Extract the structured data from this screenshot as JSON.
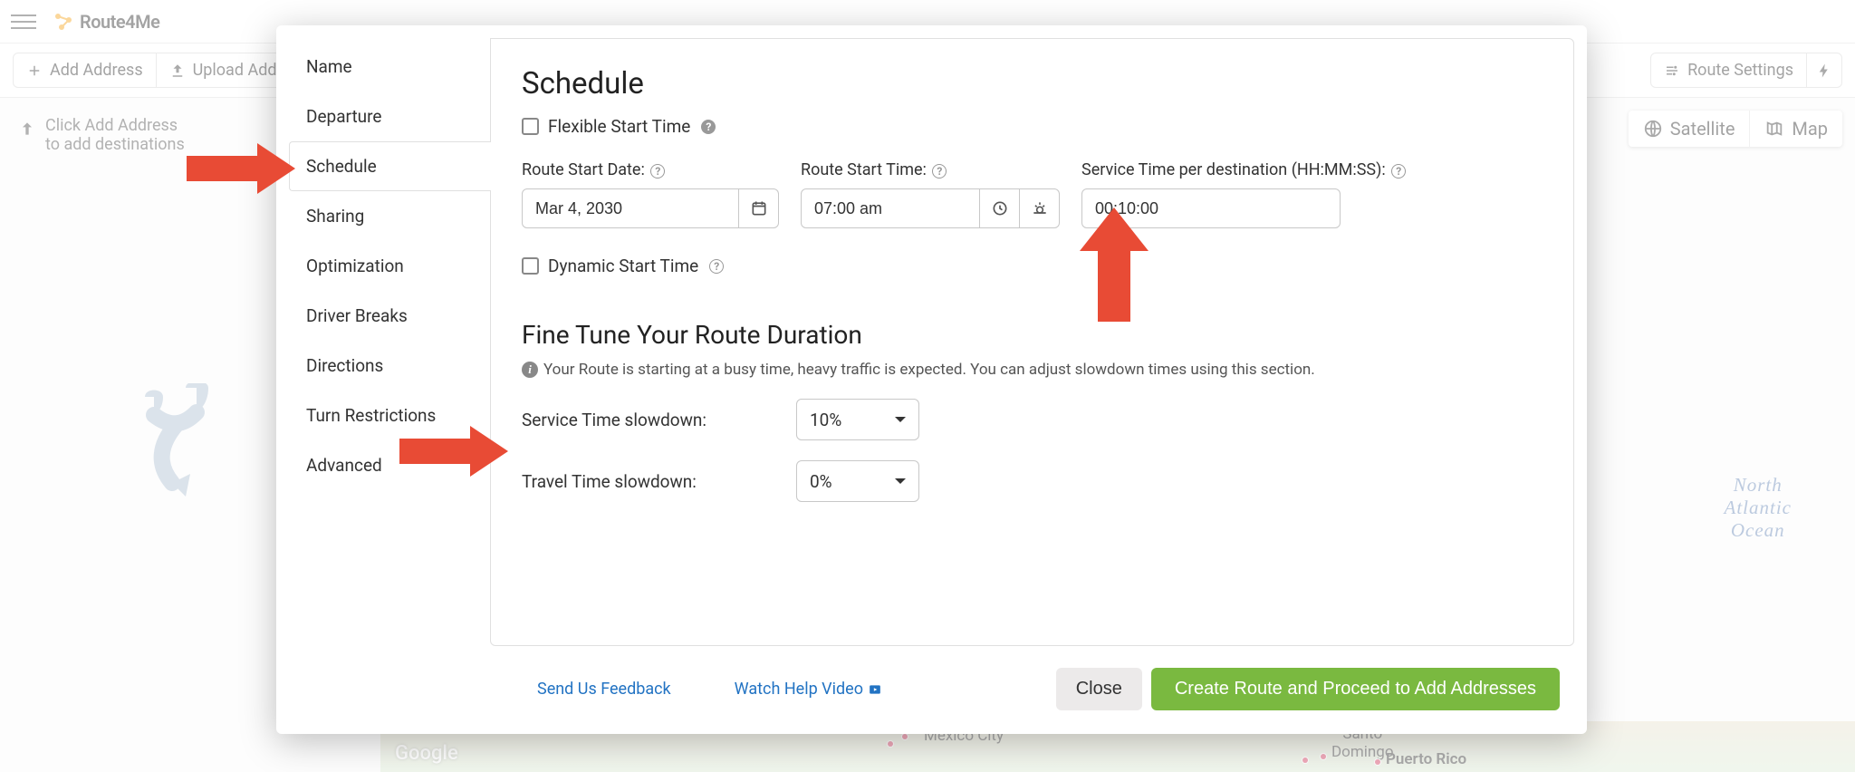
{
  "header": {
    "brand": "Route4Me"
  },
  "toolbar": {
    "add_address": "Add Address",
    "upload_addresses": "Upload Addresses",
    "route_settings": "Route Settings"
  },
  "hint": {
    "line1": "Click Add Address",
    "line2": "to add destinations"
  },
  "map": {
    "satellite": "Satellite",
    "map": "Map",
    "ocean1": "North",
    "ocean2": "Atlantic",
    "ocean3": "Ocean",
    "google": "Google",
    "city_mexico": "Mexico City",
    "city_santo1": "Santo",
    "city_santo2": "Domingo",
    "city_pr": "Puerto Rico"
  },
  "modal": {
    "nav": {
      "name": "Name",
      "departure": "Departure",
      "schedule": "Schedule",
      "sharing": "Sharing",
      "optimization": "Optimization",
      "driver_breaks": "Driver Breaks",
      "directions": "Directions",
      "turn_restrictions": "Turn Restrictions",
      "advanced": "Advanced"
    },
    "schedule": {
      "title": "Schedule",
      "flexible": "Flexible Start Time",
      "route_start_date_label": "Route Start Date:",
      "route_start_date_value": "Mar 4, 2030",
      "route_start_time_label": "Route Start Time:",
      "route_start_time_value": "07:00 am",
      "service_time_label": "Service Time per destination (HH:MM:SS):",
      "service_time_value": "00:10:00",
      "dynamic": "Dynamic Start Time"
    },
    "finetune": {
      "title": "Fine Tune Your Route Duration",
      "info": "Your Route is starting at a busy time, heavy traffic is expected. You can adjust slowdown times using this section.",
      "service_slowdown_label": "Service Time slowdown:",
      "service_slowdown_value": "10%",
      "travel_slowdown_label": "Travel Time slowdown:",
      "travel_slowdown_value": "0%"
    },
    "footer": {
      "feedback": "Send Us Feedback",
      "watch_video": "Watch Help Video",
      "close": "Close",
      "create": "Create Route and Proceed to Add Addresses"
    }
  }
}
